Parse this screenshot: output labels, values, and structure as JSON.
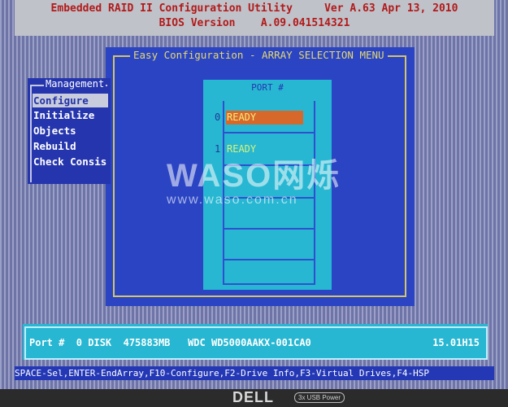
{
  "title_bar": {
    "line1": "Embedded RAID II Configuration Utility     Ver A.63 Apr 13, 2010",
    "line2": "BIOS Version    A.09.041514321"
  },
  "easy_config": {
    "title": "Easy Configuration - ARRAY SELECTION MENU"
  },
  "port_panel": {
    "header": "PORT #",
    "ports": [
      {
        "number": "0",
        "status": "READY",
        "selected": true
      },
      {
        "number": "1",
        "status": "READY",
        "selected": false
      }
    ]
  },
  "management": {
    "title": "Management",
    "items": [
      {
        "label": "Configure",
        "selected": true
      },
      {
        "label": "Initialize",
        "selected": false
      },
      {
        "label": "Objects",
        "selected": false
      },
      {
        "label": "Rebuild",
        "selected": false
      },
      {
        "label": "Check Consis",
        "selected": false
      }
    ]
  },
  "info_bar": {
    "left": "Port #  0 DISK  475883MB   WDC WD5000AAKX-001CA0",
    "right": "15.01H15"
  },
  "hint_bar": {
    "text": "SPACE-Sel,ENTER-EndArray,F10-Configure,F2-Drive Info,F3-Virtual Drives,F4-HSP"
  },
  "monitor": {
    "brand": "DELL",
    "usb_badge": "3x USB Power"
  },
  "watermark": {
    "name": "WASO网烁",
    "url": "www.waso.com.cn"
  },
  "colors": {
    "title_text": "#b21a1a",
    "window_bg": "#2a44c4",
    "panel_cyan": "#27b7d2",
    "highlight": "#d7682c",
    "frame_yellow": "#d4c46a"
  }
}
